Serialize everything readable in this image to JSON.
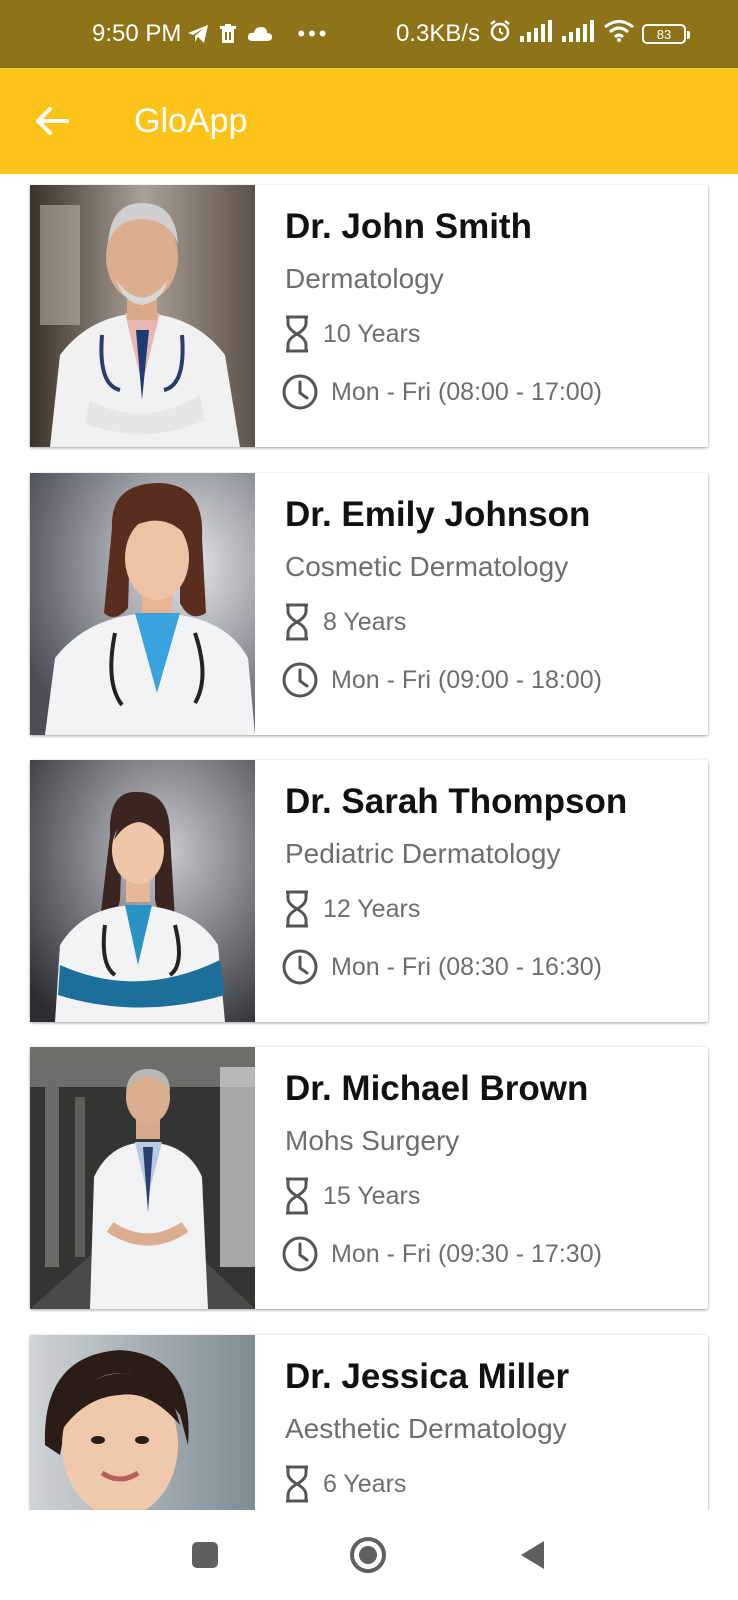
{
  "status_bar": {
    "time": "9:50 PM",
    "net_speed": "0.3KB/s",
    "battery": "83",
    "icons": [
      "telegram-icon",
      "trash-icon",
      "cloud-icon",
      "more-dots-icon",
      "alarm-icon",
      "signal-icon",
      "signal-icon",
      "wifi-icon",
      "battery-icon"
    ]
  },
  "app_bar": {
    "title": "GloApp",
    "back_icon": "arrow-left-icon",
    "color": "#fcc419"
  },
  "doctors": [
    {
      "name": "Dr. John Smith",
      "specialty": "Dermatology",
      "experience": "10 Years",
      "hours": "Mon - Fri (08:00 - 17:00)"
    },
    {
      "name": "Dr. Emily Johnson",
      "specialty": "Cosmetic Dermatology",
      "experience": "8 Years",
      "hours": "Mon - Fri (09:00 - 18:00)"
    },
    {
      "name": "Dr. Sarah Thompson",
      "specialty": "Pediatric Dermatology",
      "experience": "12 Years",
      "hours": "Mon - Fri (08:30 - 16:30)"
    },
    {
      "name": "Dr. Michael Brown",
      "specialty": "Mohs Surgery",
      "experience": "15 Years",
      "hours": "Mon - Fri (09:30 - 17:30)"
    },
    {
      "name": "Dr. Jessica Miller",
      "specialty": "Aesthetic Dermatology",
      "experience": "6 Years",
      "hours": ""
    }
  ],
  "nav_bar": {
    "icons": [
      "recent-apps-icon",
      "home-icon",
      "back-triangle-icon"
    ]
  }
}
